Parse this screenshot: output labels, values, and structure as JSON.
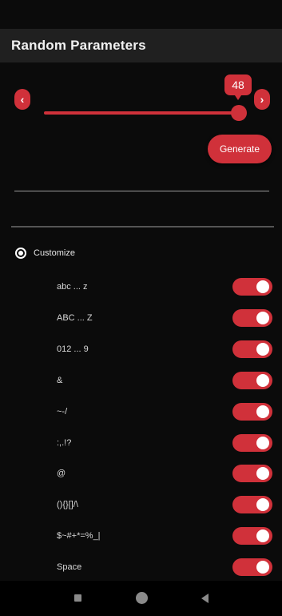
{
  "app": {
    "title": "Random Parameters"
  },
  "slider": {
    "value": "48",
    "prev_icon": "‹",
    "next_icon": "›"
  },
  "actions": {
    "generate_label": "Generate"
  },
  "output": {
    "value": ""
  },
  "customize": {
    "label": "Customize",
    "selected": true
  },
  "toggles": [
    {
      "label": "abc ... z",
      "on": true
    },
    {
      "label": "ABC ... Z",
      "on": true
    },
    {
      "label": "012 ... 9",
      "on": true
    },
    {
      "label": "&",
      "on": true
    },
    {
      "label": "~-/",
      "on": true
    },
    {
      "label": ":,.!?",
      "on": true
    },
    {
      "label": "@",
      "on": true
    },
    {
      "label": "(){}[]/\\",
      "on": true
    },
    {
      "label": "$~#+*=%_|",
      "on": true
    },
    {
      "label": "Space",
      "on": true
    }
  ],
  "colors": {
    "accent": "#d0313a",
    "background": "#0b0b0b",
    "app_bar": "#202020"
  },
  "icons": {
    "prev": "chevron-left-icon",
    "next": "chevron-right-icon",
    "recent": "recent-apps-icon",
    "home": "home-icon",
    "back": "back-icon"
  }
}
